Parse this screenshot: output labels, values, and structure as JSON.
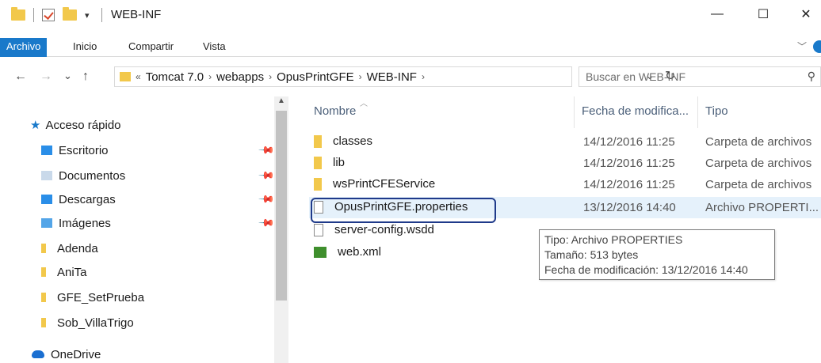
{
  "window": {
    "title": "WEB-INF",
    "minimize": "—",
    "maximize": "☐",
    "close": "✕"
  },
  "ribbon": {
    "tabs": [
      "Archivo",
      "Inicio",
      "Compartir",
      "Vista"
    ],
    "accent": "#1979ca"
  },
  "nav": {
    "back": "←",
    "forward": "→",
    "recent": "⌄",
    "up": "↑",
    "breadcrumb_overflow": "«",
    "breadcrumb": [
      "Tomcat 7.0",
      "webapps",
      "OpusPrintGFE",
      "WEB-INF"
    ],
    "refresh": "↻",
    "search_placeholder": "Buscar en WEB-INF"
  },
  "sidebar": {
    "quick_access": "Acceso rápido",
    "items": [
      {
        "label": "Escritorio",
        "icon": "desktop-folder-icon",
        "pinned": true
      },
      {
        "label": "Documentos",
        "icon": "documents-folder-icon",
        "pinned": true
      },
      {
        "label": "Descargas",
        "icon": "downloads-folder-icon",
        "pinned": true
      },
      {
        "label": "Imágenes",
        "icon": "pictures-folder-icon",
        "pinned": true
      },
      {
        "label": "Adenda",
        "icon": "folder-icon",
        "pinned": false
      },
      {
        "label": "AniTa",
        "icon": "folder-icon",
        "pinned": false
      },
      {
        "label": "GFE_SetPrueba",
        "icon": "folder-icon",
        "pinned": false
      },
      {
        "label": "Sob_VillaTrigo",
        "icon": "folder-icon",
        "pinned": false
      }
    ],
    "onedrive": "OneDrive"
  },
  "filelist": {
    "columns": {
      "name": "Nombre",
      "date": "Fecha de modifica...",
      "type": "Tipo"
    },
    "rows": [
      {
        "name": "classes",
        "date": "14/12/2016 11:25",
        "type": "Carpeta de archivos",
        "icon": "folder-icon"
      },
      {
        "name": "lib",
        "date": "14/12/2016 11:25",
        "type": "Carpeta de archivos",
        "icon": "folder-icon"
      },
      {
        "name": "wsPrintCFEService",
        "date": "14/12/2016 11:25",
        "type": "Carpeta de archivos",
        "icon": "folder-icon"
      },
      {
        "name": "OpusPrintGFE.properties",
        "date": "13/12/2016 14:40",
        "type": "Archivo PROPERTI...",
        "icon": "file-icon"
      },
      {
        "name": "server-config.wsdd",
        "date": "",
        "type": "",
        "icon": "file-icon"
      },
      {
        "name": "web.xml",
        "date": "",
        "type": "",
        "icon": "xml-file-icon"
      }
    ],
    "tooltip": [
      "Tipo: Archivo PROPERTIES",
      "Tamaño: 513 bytes",
      "Fecha de modificación: 13/12/2016 14:40"
    ]
  }
}
